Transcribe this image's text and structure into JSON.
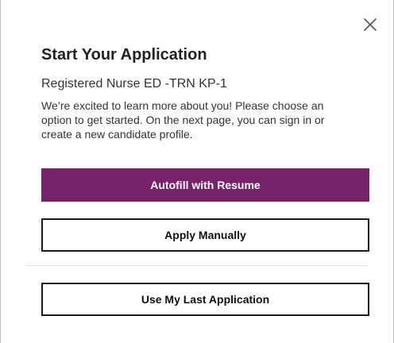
{
  "dialog": {
    "title": "Start Your Application",
    "job_title": "Registered Nurse ED -TRN KP-1",
    "intro": "We’re excited to learn more about you! Please choose an option to get started. On the next page, you can sign in or create a new candidate profile.",
    "close_icon": "close-icon",
    "buttons": {
      "autofill": "Autofill with Resume",
      "manual": "Apply Manually",
      "last": "Use My Last Application"
    }
  },
  "colors": {
    "primary": "#76236a",
    "border": "#1a1a1a"
  }
}
